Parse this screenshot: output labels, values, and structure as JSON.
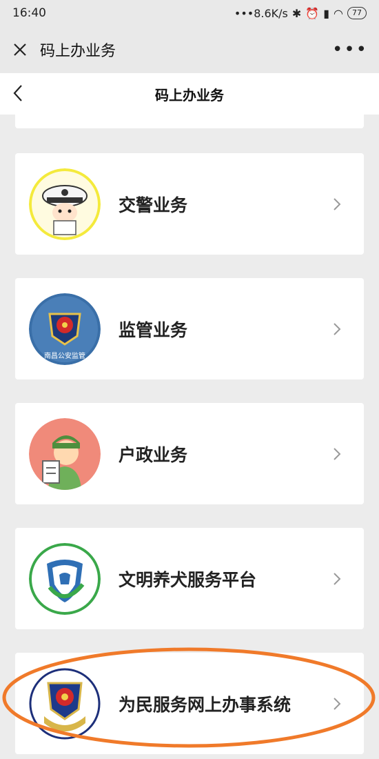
{
  "status_bar": {
    "time": "16:40",
    "speed": "•••8.6K/s",
    "battery": "77"
  },
  "top_nav": {
    "title": "码上办业务"
  },
  "sub_header": {
    "title": "码上办业务"
  },
  "services": [
    {
      "label": "交警业务",
      "icon": "traffic-police-icon"
    },
    {
      "label": "监管业务",
      "icon": "police-badge-icon",
      "icon_caption": "南昌公安监管"
    },
    {
      "label": "户政业务",
      "icon": "household-registration-icon"
    },
    {
      "label": "文明养犬服务平台",
      "icon": "dog-shield-icon"
    },
    {
      "label": "为民服务网上办事系统",
      "icon": "police-emblem-icon"
    }
  ],
  "colors": {
    "highlight": "#f07a2a",
    "background": "#ececec",
    "card": "#ffffff"
  }
}
